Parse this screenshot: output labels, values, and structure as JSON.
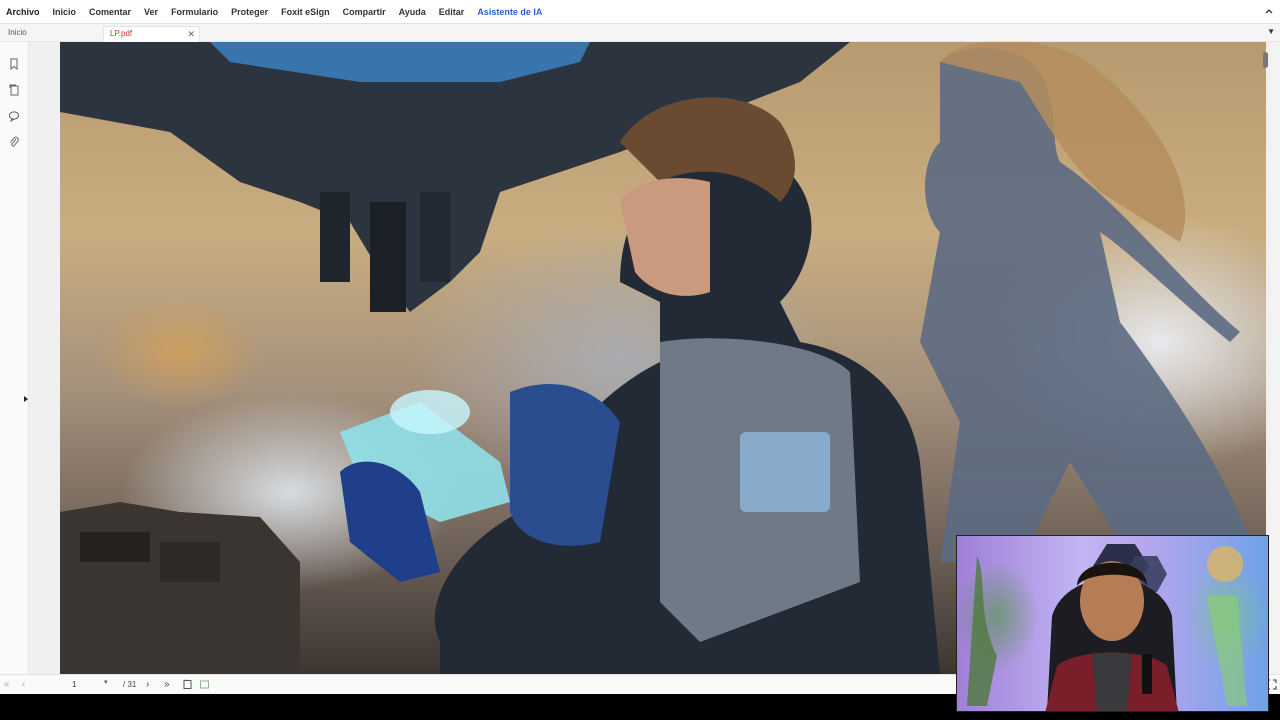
{
  "menu": {
    "items": [
      "Archivo",
      "Inicio",
      "Comentar",
      "Ver",
      "Formulario",
      "Proteger",
      "Foxit eSign",
      "Compartir",
      "Ayuda",
      "Editar",
      "Asistente de IA"
    ]
  },
  "tabs": {
    "home_label": "Inicio",
    "doc_label": "LP.pdf"
  },
  "nav": {
    "current_page": "1",
    "total_pages": "/ 31"
  },
  "colors": {
    "accent": "#2d5fd3",
    "active_tab_text": "#d13a2a"
  },
  "icons": [
    "bookmark-icon",
    "pages-icon",
    "comment-icon",
    "attachment-icon",
    "close-icon",
    "first-page-icon",
    "prev-page-icon",
    "next-page-icon",
    "last-page-icon",
    "fit-page-icon",
    "fit-width-icon",
    "fullscreen-icon"
  ]
}
